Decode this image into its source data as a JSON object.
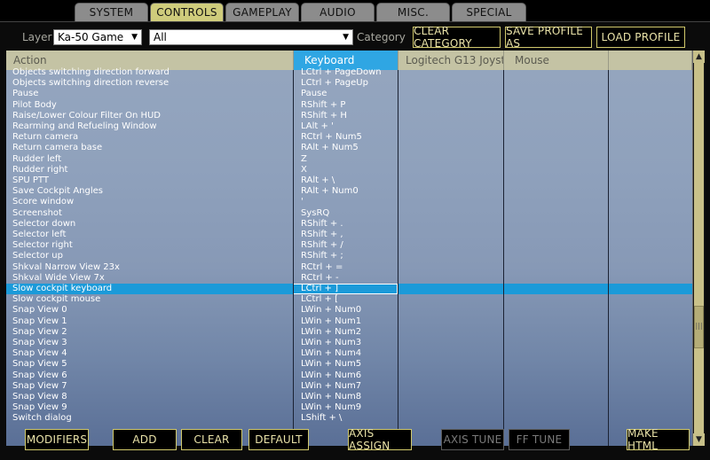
{
  "tabs": [
    {
      "label": "SYSTEM",
      "active": false
    },
    {
      "label": "CONTROLS",
      "active": true
    },
    {
      "label": "GAMEPLAY",
      "active": false
    },
    {
      "label": "AUDIO",
      "active": false
    },
    {
      "label": "MISC.",
      "active": false
    },
    {
      "label": "SPECIAL",
      "active": false
    }
  ],
  "toolbar": {
    "layer_label": "Layer",
    "layer_value": "Ka-50 Game",
    "category_value": "All",
    "category_label": "Category",
    "clear_category": "CLEAR CATEGORY",
    "save_profile_as": "SAVE PROFILE AS",
    "load_profile": "LOAD PROFILE"
  },
  "columns": {
    "action": "Action",
    "keyboard": "Keyboard",
    "logitech": "Logitech G13 Joystick",
    "mouse": "Mouse"
  },
  "rows": [
    {
      "action": "Objects switching direction forward",
      "keyboard": "LCtrl + PageDown"
    },
    {
      "action": "Objects switching direction reverse",
      "keyboard": "LCtrl + PageUp"
    },
    {
      "action": "Pause",
      "keyboard": "Pause"
    },
    {
      "action": "Pilot Body",
      "keyboard": "RShift + P"
    },
    {
      "action": "Raise/Lower Colour Filter On HUD",
      "keyboard": "RShift + H"
    },
    {
      "action": "Rearming and Refueling Window",
      "keyboard": "LAlt + '"
    },
    {
      "action": "Return camera",
      "keyboard": "RCtrl + Num5"
    },
    {
      "action": "Return camera base",
      "keyboard": "RAlt + Num5"
    },
    {
      "action": "Rudder left",
      "keyboard": "Z"
    },
    {
      "action": "Rudder right",
      "keyboard": "X"
    },
    {
      "action": "SPU PTT",
      "keyboard": "RAlt + \\"
    },
    {
      "action": "Save Cockpit Angles",
      "keyboard": "RAlt + Num0"
    },
    {
      "action": "Score window",
      "keyboard": "'"
    },
    {
      "action": "Screenshot",
      "keyboard": "SysRQ"
    },
    {
      "action": "Selector down",
      "keyboard": "RShift + ."
    },
    {
      "action": "Selector left",
      "keyboard": "RShift + ,"
    },
    {
      "action": "Selector right",
      "keyboard": "RShift + /"
    },
    {
      "action": "Selector up",
      "keyboard": "RShift + ;"
    },
    {
      "action": "Shkval Narrow View 23x",
      "keyboard": "RCtrl + ="
    },
    {
      "action": "Shkval Wide View 7x",
      "keyboard": "RCtrl + -"
    },
    {
      "action": "Slow cockpit keyboard",
      "keyboard": "LCtrl + ]",
      "selected": true
    },
    {
      "action": "Slow cockpit mouse",
      "keyboard": "LCtrl + ["
    },
    {
      "action": "Snap View 0",
      "keyboard": "LWin + Num0"
    },
    {
      "action": "Snap View 1",
      "keyboard": "LWin + Num1"
    },
    {
      "action": "Snap View 2",
      "keyboard": "LWin + Num2"
    },
    {
      "action": "Snap View 3",
      "keyboard": "LWin + Num3"
    },
    {
      "action": "Snap View 4",
      "keyboard": "LWin + Num4"
    },
    {
      "action": "Snap View 5",
      "keyboard": "LWin + Num5"
    },
    {
      "action": "Snap View 6",
      "keyboard": "LWin + Num6"
    },
    {
      "action": "Snap View 7",
      "keyboard": "LWin + Num7"
    },
    {
      "action": "Snap View 8",
      "keyboard": "LWin + Num8"
    },
    {
      "action": "Snap View 9",
      "keyboard": "LWin + Num9"
    },
    {
      "action": "Switch dialog",
      "keyboard": "LShift + \\"
    }
  ],
  "bottom": {
    "modifiers": "MODIFIERS",
    "add": "ADD",
    "clear": "CLEAR",
    "default": "DEFAULT",
    "axis_assign": "AXIS ASSIGN",
    "axis_tune": "AXIS TUNE",
    "ff_tune": "FF TUNE",
    "make_html": "MAKE HTML"
  },
  "scroll_position": 0.74,
  "colors": {
    "accent_yellow": "#d0c86a",
    "selected_blue": "#1b9ad9",
    "keyboard_header": "#2fa6e3",
    "header": "#c4c3a4"
  }
}
